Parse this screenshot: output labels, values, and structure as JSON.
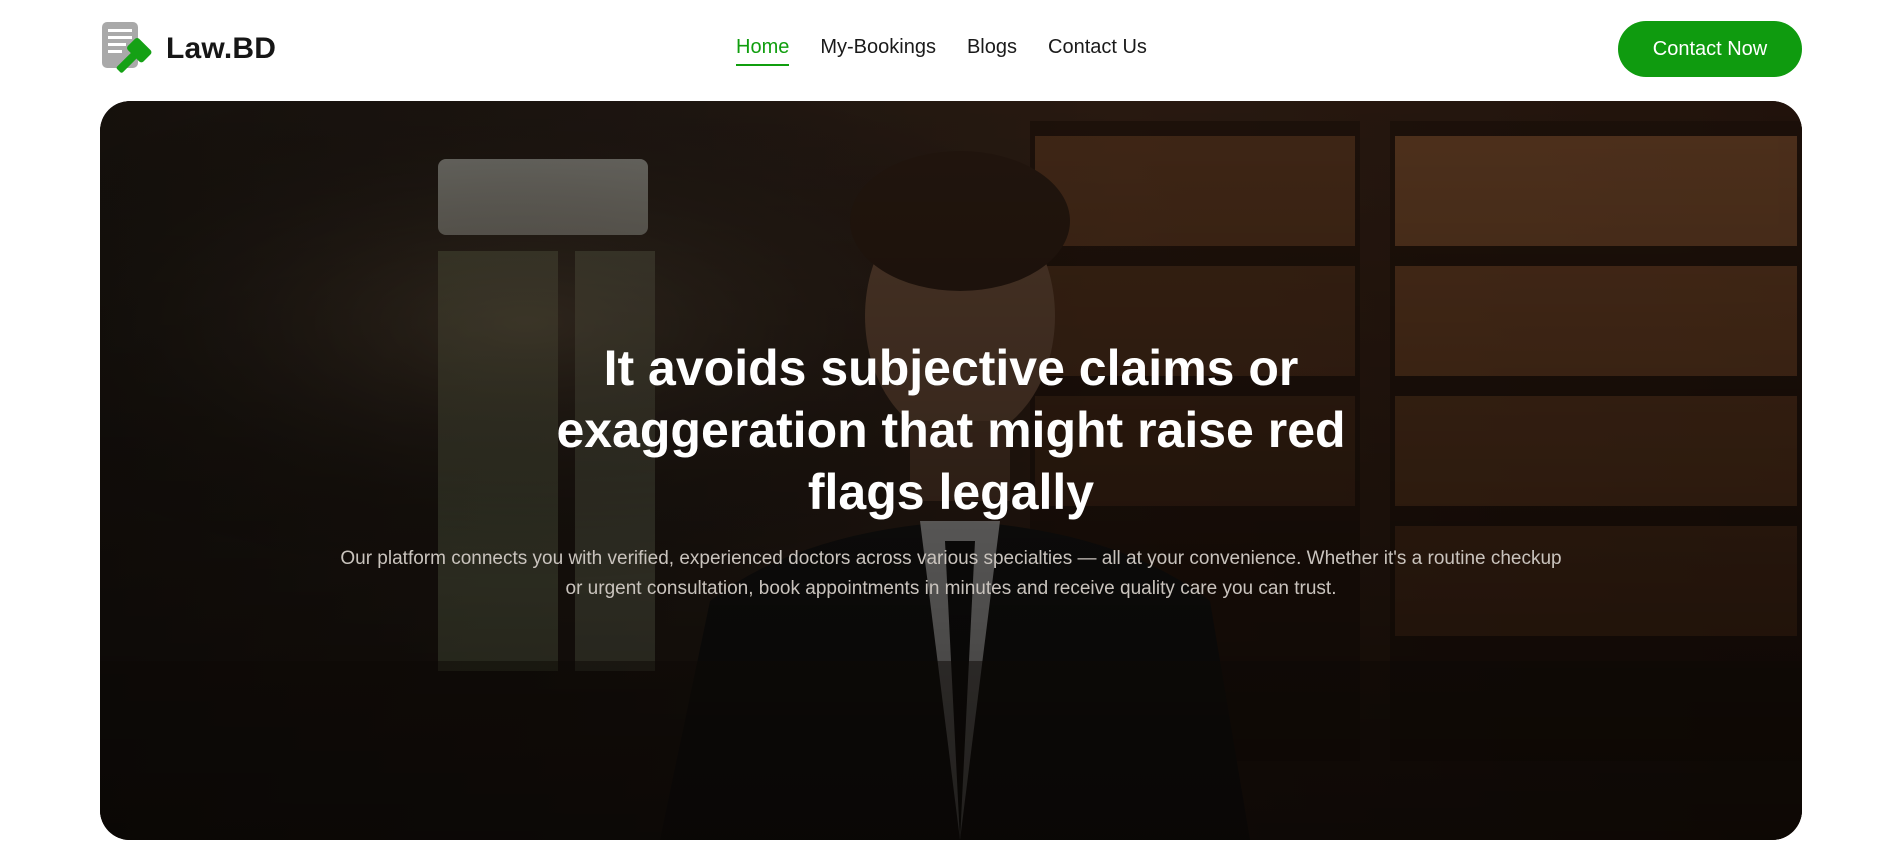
{
  "brand": {
    "name": "Law.BD",
    "logo_icon": "gavel-document-icon"
  },
  "nav": {
    "items": [
      {
        "label": "Home",
        "active": true
      },
      {
        "label": "My-Bookings",
        "active": false
      },
      {
        "label": "Blogs",
        "active": false
      },
      {
        "label": "Contact Us",
        "active": false
      }
    ]
  },
  "header": {
    "cta_label": "Contact Now"
  },
  "hero": {
    "title": "It avoids subjective claims or exaggeration that might raise red flags legally",
    "description": "Our platform connects you with verified, experienced doctors across various specialties — all at your convenience. Whether it's a routine checkup or urgent consultation, book appointments in minutes and receive quality care you can trust.",
    "background_image": "lawyer-in-library-photo"
  },
  "colors": {
    "accent": "#0f9b0f",
    "text": "#1a1a1a",
    "background": "#ffffff"
  }
}
